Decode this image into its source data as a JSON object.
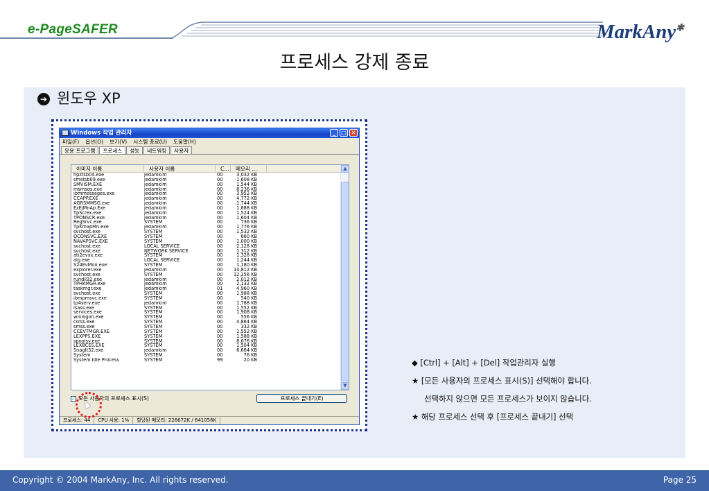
{
  "header": {
    "brand_left": "e-PageSAFER",
    "brand_right": "MarkAny",
    "title": "프로세스 강제 종료"
  },
  "section": {
    "heading": "윈도우 XP",
    "bullet_icon": "circle-arrow-right-icon"
  },
  "task_manager": {
    "window_title": "Windows 작업 관리자",
    "menu": [
      "파일(F)",
      "옵션(O)",
      "보기(V)",
      "시스템 종료(U)",
      "도움말(H)"
    ],
    "tabs": [
      "응용 프로그램",
      "프로세스",
      "성능",
      "네트워킹",
      "사용자"
    ],
    "active_tab": "프로세스",
    "columns": [
      "이미지 이름",
      "사용자 이름",
      "C...",
      "메모리 ..."
    ],
    "rows": [
      [
        "hpztsb04.exe",
        "jedamkim",
        "00",
        "3,032 KB"
      ],
      [
        "smstsb09.exe",
        "jedamkim",
        "00",
        "1,608 KB"
      ],
      [
        "SMVISM.EXE",
        "jedamkim",
        "00",
        "1,544 KB"
      ],
      [
        "msmsgs.exe",
        "jedamkim",
        "00",
        "8,236 KB"
      ],
      [
        "ibmmessages.exe",
        "jedamkim",
        "00",
        "3,952 KB"
      ],
      [
        "CCAPP.EXE",
        "jedamkim",
        "00",
        "4,772 KB"
      ],
      [
        "AGRSMMSG.exe",
        "jedamkim",
        "00",
        "1,744 KB"
      ],
      [
        "EzEjMnAp.Exe",
        "jedamkim",
        "00",
        "1,888 KB"
      ],
      [
        "TpScrex.exe",
        "jedamkim",
        "00",
        "1,524 KB"
      ],
      [
        "TPONSCR.exe",
        "jedamkim",
        "00",
        "1,604 KB"
      ],
      [
        "RegSrvc.exe",
        "SYSTEM",
        "00",
        "736 KB"
      ],
      [
        "TpKmapMn.exe",
        "jedamkim",
        "00",
        "1,776 KB"
      ],
      [
        "svchost.exe",
        "SYSTEM",
        "00",
        "1,532 KB"
      ],
      [
        "QCONSVC.EXE",
        "SYSTEM",
        "00",
        "660 KB"
      ],
      [
        "NAVAPSVC.EXE",
        "SYSTEM",
        "00",
        "1,000 KB"
      ],
      [
        "svchost.exe",
        "LOCAL SERVICE",
        "00",
        "2,128 KB"
      ],
      [
        "svchost.exe",
        "NETWORK SERVICE",
        "00",
        "1,312 KB"
      ],
      [
        "ati2evxx.exe",
        "SYSTEM",
        "00",
        "1,328 KB"
      ],
      [
        "alg.exe",
        "LOCAL SERVICE",
        "00",
        "1,244 KB"
      ],
      [
        "S24EvMon.exe",
        "SYSTEM",
        "00",
        "1,180 KB"
      ],
      [
        "explorer.exe",
        "jedamkim",
        "00",
        "14,812 KB"
      ],
      [
        "svchost.exe",
        "SYSTEM",
        "00",
        "12,256 KB"
      ],
      [
        "rundll32.exe",
        "jedamkim",
        "00",
        "2,012 KB"
      ],
      [
        "TPHKMGR.exe",
        "jedamkim",
        "00",
        "2,132 KB"
      ],
      [
        "taskmgr.exe",
        "jedamkim",
        "01",
        "4,960 KB"
      ],
      [
        "svchost.exe",
        "SYSTEM",
        "00",
        "1,988 KB"
      ],
      [
        "ibmpmsvc.exe",
        "SYSTEM",
        "00",
        "540 KB"
      ],
      [
        "tp4serv.exe",
        "jedamkim",
        "00",
        "1,788 KB"
      ],
      [
        "lsass.exe",
        "SYSTEM",
        "00",
        "1,552 KB"
      ],
      [
        "services.exe",
        "SYSTEM",
        "00",
        "1,908 KB"
      ],
      [
        "winlogon.exe",
        "SYSTEM",
        "00",
        "556 KB"
      ],
      [
        "csrss.exe",
        "SYSTEM",
        "00",
        "4,864 KB"
      ],
      [
        "smss.exe",
        "SYSTEM",
        "00",
        "332 KB"
      ],
      [
        "CCEVTMGR.EXE",
        "SYSTEM",
        "00",
        "1,552 KB"
      ],
      [
        "LEXPPS.EXE",
        "SYSTEM",
        "00",
        "1,588 KB"
      ],
      [
        "spoolsv.exe",
        "SYSTEM",
        "00",
        "8,676 KB"
      ],
      [
        "LEXBCES.EXE",
        "SYSTEM",
        "00",
        "1,504 KB"
      ],
      [
        "SnagIt32.exe",
        "jedamkim",
        "00",
        "6,664 KB"
      ],
      [
        "System",
        "SYSTEM",
        "00",
        "76 KB"
      ],
      [
        "System Idle Process",
        "SYSTEM",
        "99",
        "20 KB"
      ]
    ],
    "show_all_users_label": "모든 사용자의 프로세스 표시(S)",
    "end_process_label": "프로세스 끝내기(E)",
    "status": {
      "processes": "프로세스: 44",
      "cpu": "CPU 사용: 1%",
      "memory": "할당된 메모리: 226672K / 641056K"
    }
  },
  "notes": [
    {
      "text": "◆ [Ctrl] + [Alt] + [Del] 작업관리자 실행",
      "indent": false
    },
    {
      "text": "★ [모든 사용자의 프로세스 표시(S)] 선택해야 합니다.",
      "indent": false
    },
    {
      "text": "선택하지 않으면 모든 프로세스가 보이지 않습니다.",
      "indent": true
    },
    {
      "text": "★ 해당 프로세스 선택 후 [프로세스 끝내기] 선택",
      "indent": false
    }
  ],
  "footer": {
    "copyright": "Copyright © 2004 MarkAny, Inc. All rights reserved.",
    "page": "Page 25"
  },
  "colors": {
    "footer_bg": "#3f65a8",
    "panel_bg": "#e8eef7",
    "frame_border": "#1d2f8a",
    "highlight_circle": "#e0191a",
    "brand_green": "#1f8a1f",
    "brand_navy": "#1c3e78"
  }
}
